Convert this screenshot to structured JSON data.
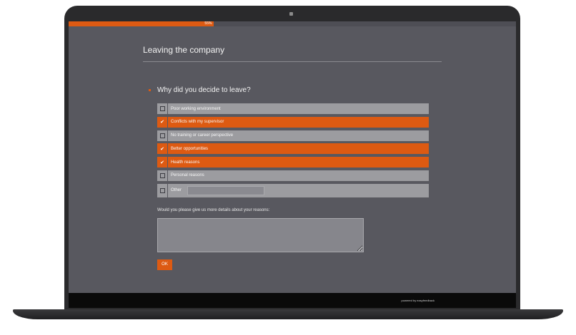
{
  "progress": {
    "percent_label": "55%",
    "fraction": 0.325
  },
  "section": {
    "title": "Leaving the company"
  },
  "question": {
    "text": "Why did you decide to leave?"
  },
  "options": [
    {
      "label": "Poor working environment",
      "checked": false
    },
    {
      "label": "Conflicts with my supervisor",
      "checked": true
    },
    {
      "label": "No training or career perspective",
      "checked": false
    },
    {
      "label": "Better opportunities",
      "checked": true
    },
    {
      "label": "Health reasons",
      "checked": true
    },
    {
      "label": "Personal reasons",
      "checked": false
    },
    {
      "label": "Other",
      "checked": false,
      "has_input": true
    }
  ],
  "details": {
    "label": "Would you please give us more details about your reasons:",
    "value": ""
  },
  "ok_button": {
    "label": "OK"
  },
  "footer": {
    "powered_by": "powered by easyfeedback"
  },
  "colors": {
    "accent": "#dd5a12",
    "screen_bg": "#58585f",
    "option_bg": "#9c9ca0",
    "footer_bg": "#0a0a0a"
  },
  "icons": {
    "checkmark": "check-icon",
    "empty_box": "checkbox-empty-icon"
  }
}
